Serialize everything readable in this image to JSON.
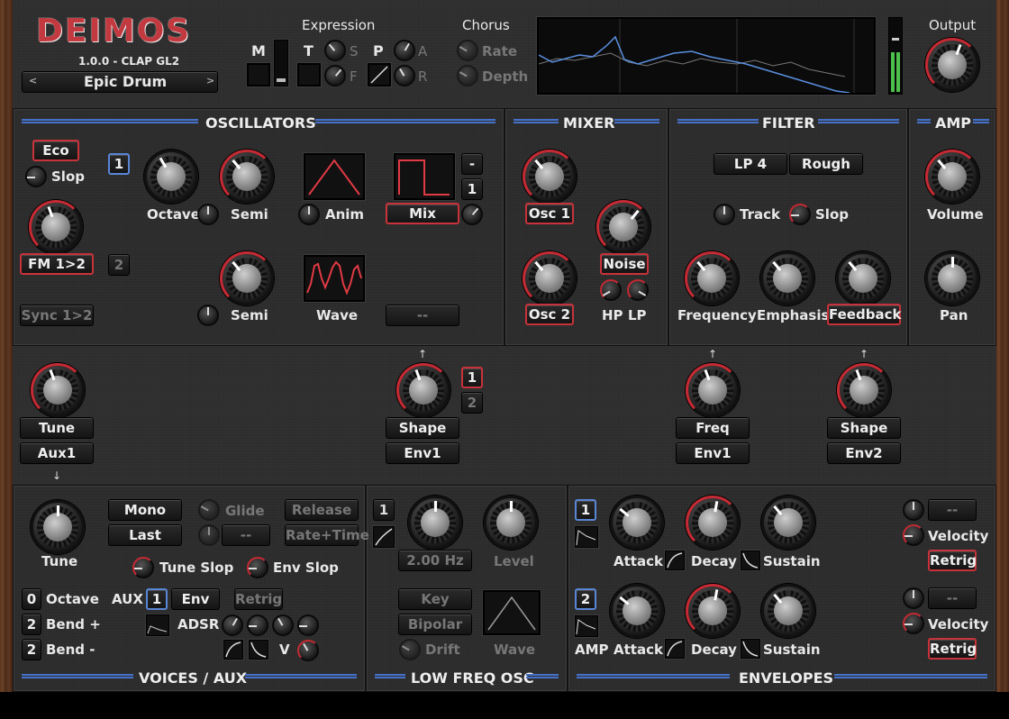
{
  "header": {
    "logo": "DEIMOS",
    "version": "1.0.0 - CLAP GL2",
    "preset": "Epic Drum",
    "preset_prev": "<",
    "preset_next": ">",
    "expression": "Expression",
    "chorus": "Chorus",
    "output": "Output",
    "m": "M",
    "t": "T",
    "p": "P",
    "s": "S",
    "f": "F",
    "a": "A",
    "r": "R",
    "rate": "Rate",
    "depth": "Depth"
  },
  "oscillators": {
    "title": "OSCILLATORS",
    "eco": "Eco",
    "slop": "Slop",
    "osc1_num": "1",
    "osc2_num": "2",
    "octave": "Octave",
    "semi": "Semi",
    "anim": "Anim",
    "mix": "Mix",
    "fm": "FM 1>2",
    "sync": "Sync 1>2",
    "semi2": "Semi",
    "wave": "Wave",
    "dash": "--",
    "minus": "-",
    "one": "1"
  },
  "mixer": {
    "title": "MIXER",
    "osc1": "Osc 1",
    "osc2": "Osc 2",
    "noise": "Noise",
    "hp": "HP",
    "lp": "LP"
  },
  "filter": {
    "title": "FILTER",
    "lp4": "LP 4",
    "rough": "Rough",
    "track": "Track",
    "slop": "Slop",
    "frequency": "Frequency",
    "emphasis": "Emphasis",
    "feedback": "Feedback"
  },
  "amp": {
    "title": "AMP",
    "volume": "Volume",
    "pan": "Pan"
  },
  "mod": {
    "tune": "Tune",
    "aux1": "Aux1",
    "shape": "Shape",
    "env1": "Env1",
    "one": "1",
    "two": "2",
    "freq": "Freq",
    "env1b": "Env1",
    "shape2": "Shape",
    "env2": "Env2"
  },
  "voices": {
    "title": "VOICES / AUX",
    "tune": "Tune",
    "mono": "Mono",
    "last": "Last",
    "glide": "Glide",
    "release": "Release",
    "dash": "--",
    "rate_time": "Rate+Time",
    "tune_slop": "Tune Slop",
    "env_slop": "Env Slop",
    "octave_val": "0",
    "octave": "Octave",
    "bendp_val": "2",
    "bendp": "Bend +",
    "bendm_val": "2",
    "bendm": "Bend -",
    "aux": "AUX",
    "aux_num": "1",
    "env": "Env",
    "retrig": "Retrig",
    "adsr": "ADSR",
    "v": "V"
  },
  "lfo": {
    "title": "LOW FREQ OSC",
    "num": "1",
    "rate": "2.00 Hz",
    "level": "Level",
    "key": "Key",
    "bipolar": "Bipolar",
    "drift": "Drift",
    "wave": "Wave"
  },
  "envelopes": {
    "title": "ENVELOPES",
    "e1": "1",
    "e2": "2",
    "attack": "Attack",
    "decay": "Decay",
    "sustain": "Sustain",
    "velocity": "Velocity",
    "retrig": "Retrig",
    "dash": "--",
    "amp": "AMP"
  }
}
